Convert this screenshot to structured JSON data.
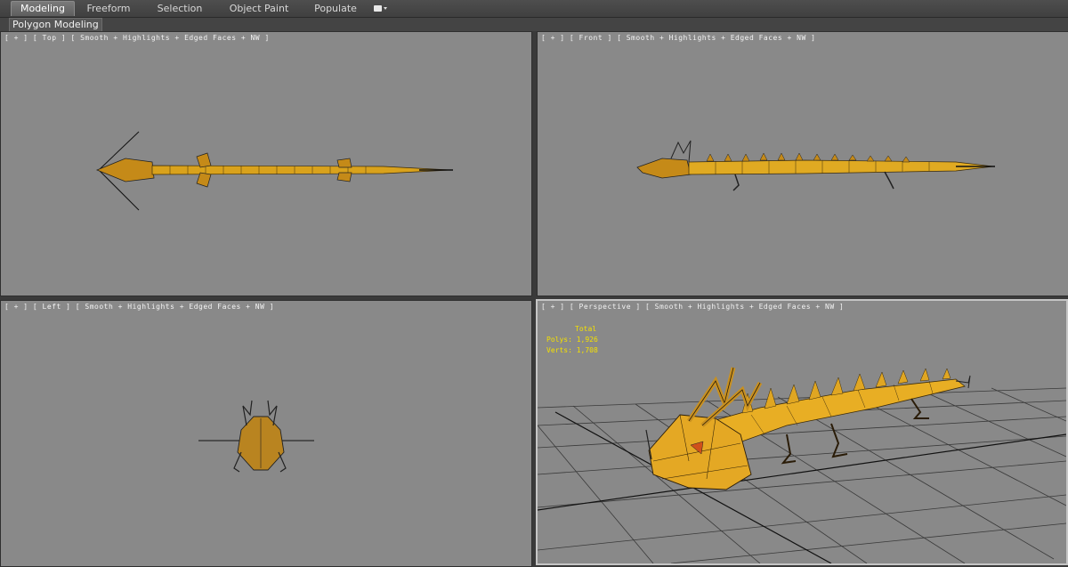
{
  "ribbon": {
    "tabs": [
      "Modeling",
      "Freeform",
      "Selection",
      "Object Paint",
      "Populate"
    ],
    "active_tab": "Modeling",
    "panel_label": "Polygon Modeling"
  },
  "viewports": {
    "top": {
      "plus": "[ + ]",
      "view": "[ Top ]",
      "mode": "[ Smooth + Highlights + Edged Faces + NW ]"
    },
    "front": {
      "plus": "[ + ]",
      "view": "[ Front ]",
      "mode": "[ Smooth + Highlights + Edged Faces + NW ]"
    },
    "left": {
      "plus": "[ + ]",
      "view": "[ Left ]",
      "mode": "[ Smooth + Highlights + Edged Faces + NW ]"
    },
    "perspective": {
      "plus": "[ + ]",
      "view": "[ Perspective ]",
      "mode": "[ Smooth + Highlights + Edged Faces + NW ]"
    }
  },
  "stats": {
    "header": "Total",
    "polys_label": "Polys:",
    "polys_value": "1,926",
    "verts_label": "Verts:",
    "verts_value": "1,708"
  },
  "colors": {
    "viewport_bg": "#898989",
    "model_gold": "#d9a21c",
    "wire": "#2a2010",
    "stats_yellow": "#f4e000"
  }
}
